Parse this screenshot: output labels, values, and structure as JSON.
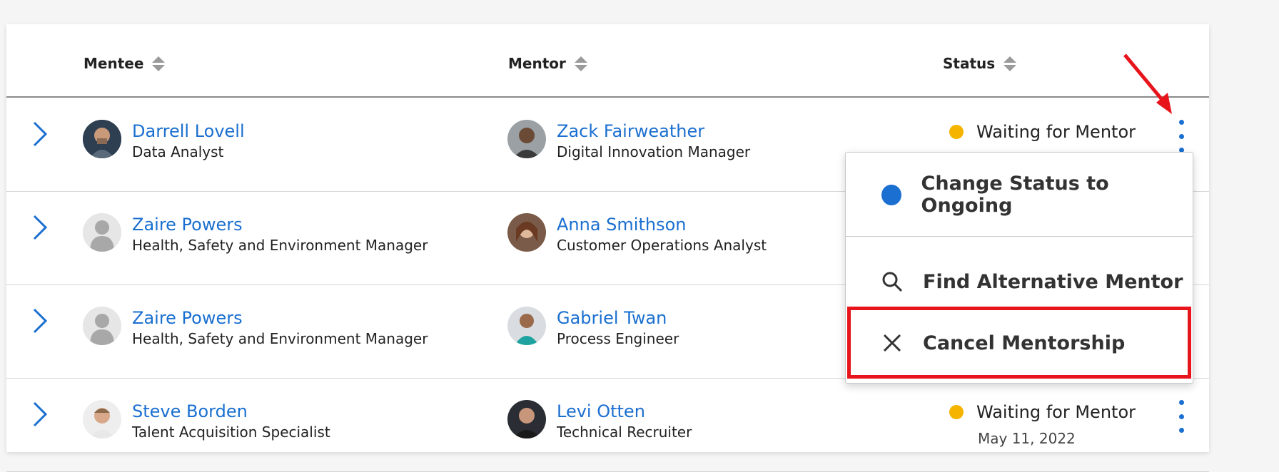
{
  "table": {
    "headers": {
      "mentee": "Mentee",
      "mentor": "Mentor",
      "status": "Status"
    },
    "rows": [
      {
        "mentee": {
          "name": "Darrell Lovell",
          "role": "Data Analyst"
        },
        "mentor": {
          "name": "Zack Fairweather",
          "role": "Digital Innovation Manager"
        },
        "status": {
          "label": "Waiting for Mentor",
          "color": "#f5b400"
        }
      },
      {
        "mentee": {
          "name": "Zaire Powers",
          "role": "Health, Safety and Environment Manager"
        },
        "mentor": {
          "name": "Anna Smithson",
          "role": "Customer Operations Analyst"
        }
      },
      {
        "mentee": {
          "name": "Zaire Powers",
          "role": "Health, Safety and Environment Manager"
        },
        "mentor": {
          "name": "Gabriel Twan",
          "role": "Process Engineer"
        }
      },
      {
        "mentee": {
          "name": "Steve Borden",
          "role": "Talent Acquisition Specialist"
        },
        "mentor": {
          "name": "Levi Otten",
          "role": "Technical Recruiter"
        },
        "status": {
          "label": "Waiting for Mentor",
          "date": "May 11, 2022",
          "color": "#f5b400"
        }
      }
    ]
  },
  "menu": {
    "items": [
      {
        "label": "Change Status to Ongoing",
        "icon": "blue-dot-icon",
        "color": "#1a6fd0"
      },
      {
        "label": "Find Alternative Mentor",
        "icon": "search-icon"
      },
      {
        "label": "Cancel Mentorship",
        "icon": "close-icon"
      }
    ]
  },
  "annotations": {
    "arrow_color": "#e8141c",
    "highlight_color": "#e8141c"
  }
}
